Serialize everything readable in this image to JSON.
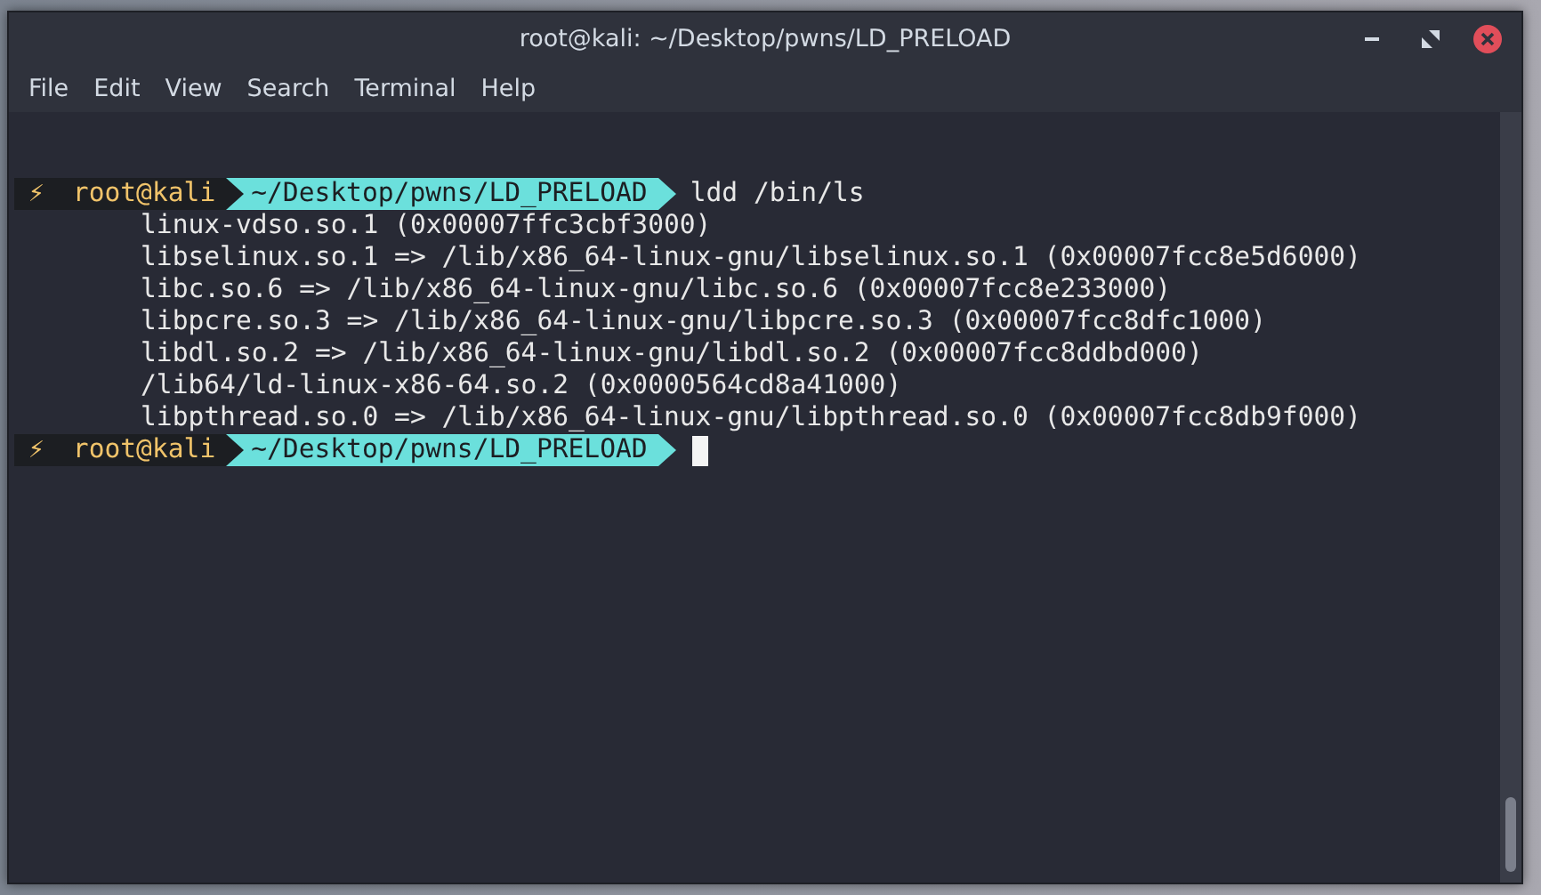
{
  "window": {
    "title": "root@kali: ~/Desktop/pwns/LD_PRELOAD"
  },
  "menu": [
    "File",
    "Edit",
    "View",
    "Search",
    "Terminal",
    "Help"
  ],
  "lines": [
    {
      "kind": "prompt",
      "symbol": "⚡",
      "user": "root@kali",
      "path": "~/Desktop/pwns/LD_PRELOAD",
      "command": "ldd /bin/ls",
      "cursor": false
    },
    {
      "kind": "output",
      "text": "linux-vdso.so.1 (0x00007ffc3cbf3000)"
    },
    {
      "kind": "output",
      "text": "libselinux.so.1 => /lib/x86_64-linux-gnu/libselinux.so.1 (0x00007fcc8e5d6000)"
    },
    {
      "kind": "output",
      "text": "libc.so.6 => /lib/x86_64-linux-gnu/libc.so.6 (0x00007fcc8e233000)"
    },
    {
      "kind": "output",
      "text": "libpcre.so.3 => /lib/x86_64-linux-gnu/libpcre.so.3 (0x00007fcc8dfc1000)"
    },
    {
      "kind": "output",
      "text": "libdl.so.2 => /lib/x86_64-linux-gnu/libdl.so.2 (0x00007fcc8ddbd000)"
    },
    {
      "kind": "output",
      "text": "/lib64/ld-linux-x86-64.so.2 (0x0000564cd8a41000)"
    },
    {
      "kind": "output",
      "text": "libpthread.so.0 => /lib/x86_64-linux-gnu/libpthread.so.0 (0x00007fcc8db9f000)"
    },
    {
      "kind": "prompt",
      "symbol": "⚡",
      "user": "root@kali",
      "path": "~/Desktop/pwns/LD_PRELOAD",
      "cursor": true
    }
  ]
}
